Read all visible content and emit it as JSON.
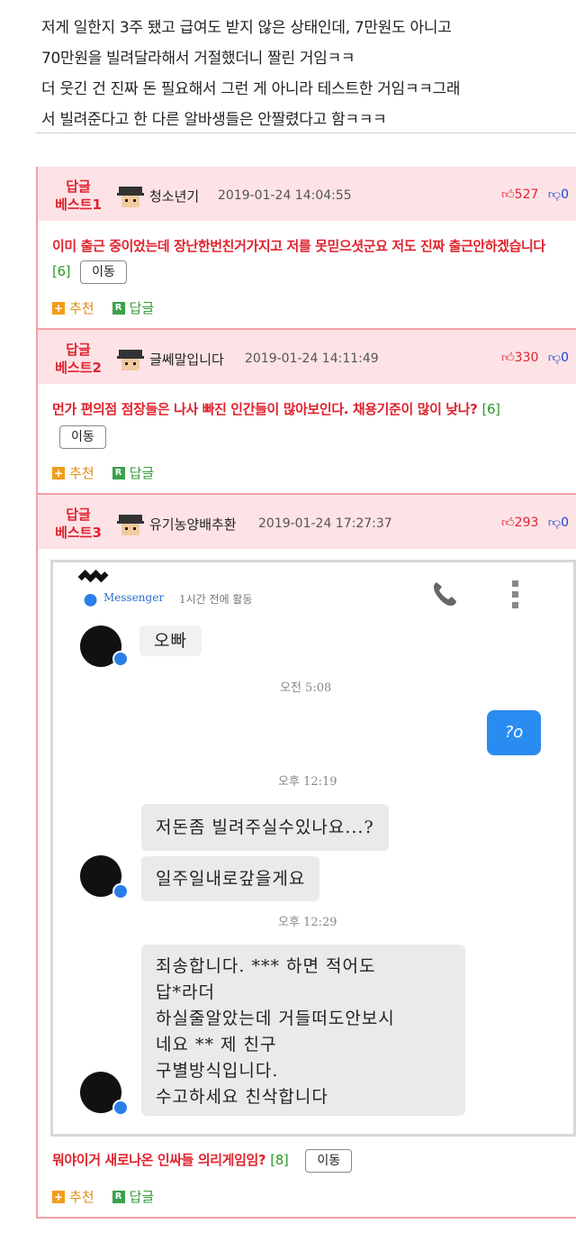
{
  "intro": {
    "lines": [
      "저게 일한지 3주 됐고 급여도 받지 않은 상태인데, 7만원도 아니고",
      "70만원을 빌려달라해서 거절했더니 짤린 거임ㅋㅋ",
      "더 웃긴 건 진짜 돈 필요해서 그런 게 아니라 테스트한 거임ㅋㅋ그래",
      "서 빌려준다고 한 다른 알바생들은 안짤렸다고 함ㅋㅋㅋ"
    ]
  },
  "comments": [
    {
      "best_line1": "답글",
      "best_line2": "베스트1",
      "nick": "청소년기",
      "date": "2019-01-24 14:04:55",
      "up": "527",
      "down": "0",
      "text": "이미 출근 중이었는데 장난한번친거가지고 저를 못믿으셧군요 저도 진짜 출근안하겠습니다",
      "count": "[6]",
      "move_label": "이동",
      "recommend_label": "추천",
      "reply_label": "답글"
    },
    {
      "best_line1": "답글",
      "best_line2": "베스트2",
      "nick": "글쎄말입니다",
      "date": "2019-01-24 14:11:49",
      "up": "330",
      "down": "0",
      "text": "먼가 편의점 점장들은 나사 빠진 인간들이 많아보인다. 채용기준이 많이 낮나?",
      "count": "[6]",
      "move_label": "이동",
      "recommend_label": "추천",
      "reply_label": "답글"
    },
    {
      "best_line1": "답글",
      "best_line2": "베스트3",
      "nick": "유기농양배추환",
      "date": "2019-01-24 17:27:37",
      "up": "293",
      "down": "0",
      "text": "뭐야이거 새로나온 인싸들 의리게임임?",
      "count": "[8]",
      "move_label": "이동",
      "recommend_label": "추천",
      "reply_label": "답글"
    }
  ],
  "screenshot": {
    "app_name": "Messenger",
    "status": "1시간 전에 활동",
    "msg1": "오빠",
    "time1": "오전 5:08",
    "my_msg": "?o",
    "time2": "오후 12:19",
    "msg2": "저돈좀 빌려주실수있나요...?",
    "msg3": "일주일내로갚을게요",
    "time3": "오후 12:29",
    "msg4_lines": [
      "죄송합니다. *** 하면 적어도",
      "답*라더",
      "하실줄알았는데 거들떠도안보시",
      "네요 ** 제 친구",
      "구별방식입니다.",
      "수고하세요 친삭합니다"
    ]
  },
  "colors": {
    "accent_red": "#e0222d",
    "header_pink": "#fde3e6",
    "down_blue": "#1c45d6",
    "messenger_blue": "#2a8cf0"
  }
}
